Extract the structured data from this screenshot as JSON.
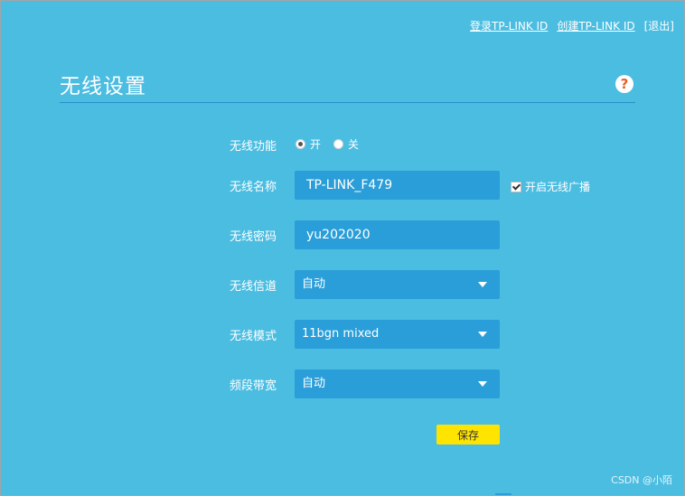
{
  "top_links": {
    "login": "登录TP-LINK ID",
    "create": "创建TP-LINK ID",
    "logout": "[退出]"
  },
  "page": {
    "title": "无线设置",
    "help_symbol": "?"
  },
  "form": {
    "wireless_function": {
      "label": "无线功能",
      "options": [
        "开",
        "关"
      ],
      "selected": "开"
    },
    "ssid": {
      "label": "无线名称",
      "value": "TP-LINK_F479",
      "broadcast_label": "开启无线广播",
      "broadcast_checked": true
    },
    "password": {
      "label": "无线密码",
      "value": "yu202020"
    },
    "channel": {
      "label": "无线信道",
      "value": "自动"
    },
    "mode": {
      "label": "无线模式",
      "value": "11bgn mixed"
    },
    "bandwidth": {
      "label": "频段带宽",
      "value": "自动"
    },
    "save_label": "保存"
  },
  "watermark": "CSDN @小陌",
  "colors": {
    "background": "#4bbde1",
    "field": "#2a9ed8",
    "save_button": "#ffe400",
    "help_icon_mark": "#e0632b"
  }
}
